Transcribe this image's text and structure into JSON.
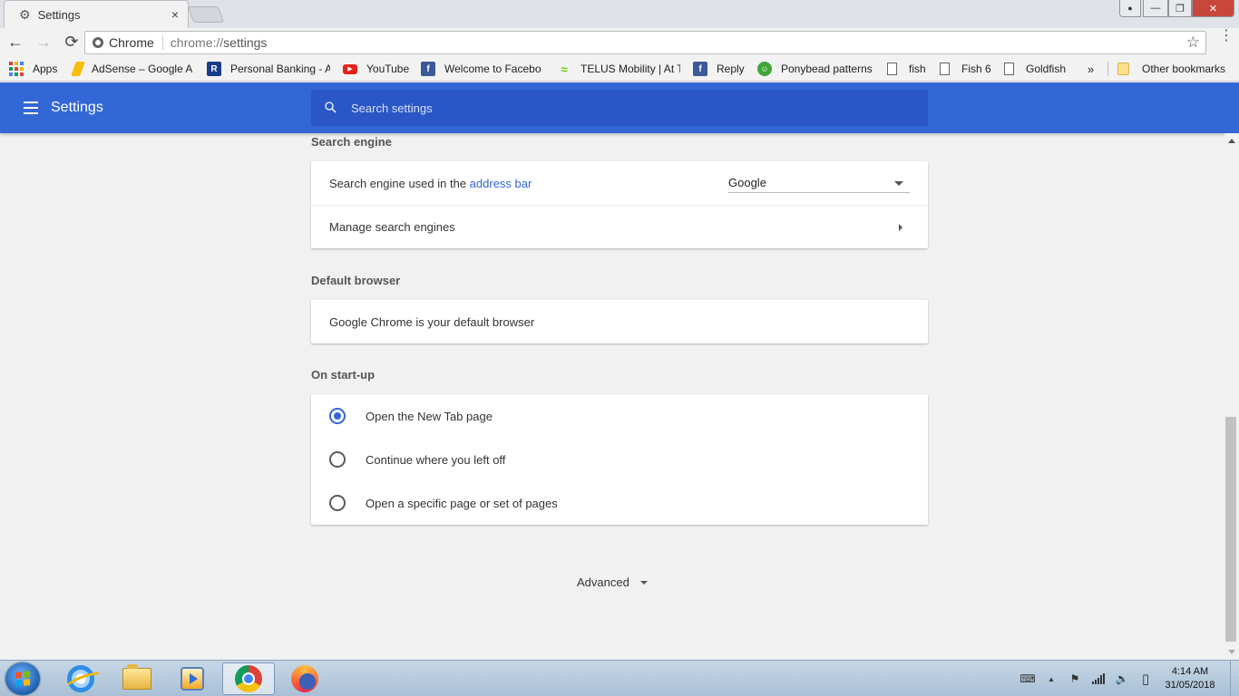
{
  "window": {
    "tab_title": "Settings",
    "tab_close": "×",
    "controls": {
      "minimize": "—",
      "maximize": "❐",
      "close": "✕",
      "user": "👤"
    }
  },
  "toolbar": {
    "back": "←",
    "forward": "→",
    "reload": "⟳",
    "omnibox_chip": "Chrome",
    "url_scheme": "chrome://",
    "url_path": "settings",
    "star": "☆",
    "menu": "⋮"
  },
  "bookmarks": [
    {
      "label": "Apps",
      "icon": "apps-grid-icon"
    },
    {
      "label": "AdSense – Google A",
      "icon": "adsense-icon",
      "color": "#fbbc04"
    },
    {
      "label": "Personal Banking - A",
      "icon": "bank-icon",
      "color": "#1b3c8c"
    },
    {
      "label": "YouTube",
      "icon": "youtube-icon",
      "color": "#e62117"
    },
    {
      "label": "Welcome to Facebo",
      "icon": "facebook-icon",
      "color": "#3b5998"
    },
    {
      "label": "TELUS Mobility | At T",
      "icon": "telus-icon",
      "color": "#66cc00"
    },
    {
      "label": "Reply",
      "icon": "facebook-icon",
      "color": "#3b5998"
    },
    {
      "label": "Ponybead patterns",
      "icon": "smiley-icon",
      "color": "#3fa535"
    },
    {
      "label": "fish",
      "icon": "page-icon"
    },
    {
      "label": "Fish 6",
      "icon": "page-icon"
    },
    {
      "label": "Goldfish",
      "icon": "page-icon"
    }
  ],
  "bookmarks_overflow": "»",
  "other_bookmarks": "Other bookmarks",
  "header": {
    "title": "Settings",
    "search_placeholder": "Search settings"
  },
  "sections": {
    "search_engine": {
      "title": "Search engine",
      "used_prefix": "Search engine used in the ",
      "used_link": "address bar",
      "selected_engine": "Google",
      "manage": "Manage search engines"
    },
    "default_browser": {
      "title": "Default browser",
      "status": "Google Chrome is your default browser"
    },
    "startup": {
      "title": "On start-up",
      "options": [
        {
          "label": "Open the New Tab page",
          "checked": true
        },
        {
          "label": "Continue where you left off",
          "checked": false
        },
        {
          "label": "Open a specific page or set of pages",
          "checked": false
        }
      ]
    },
    "advanced_label": "Advanced"
  },
  "taskbar": {
    "apps": [
      "internet-explorer-icon",
      "file-explorer-icon",
      "media-player-icon",
      "chrome-icon",
      "firefox-icon"
    ],
    "active_app": "chrome-icon",
    "tray": {
      "keyboard": "⌨",
      "show_hidden": "▲",
      "flag": "⚑",
      "signal": "▮",
      "volume": "🔈",
      "battery": "▯"
    },
    "time": "4:14 AM",
    "date": "31/05/2018"
  },
  "colors": {
    "header_blue": "#3367d6",
    "search_blue": "#2a56c6",
    "radio_checked": "#3367d6",
    "close_button": "#c7483b"
  }
}
